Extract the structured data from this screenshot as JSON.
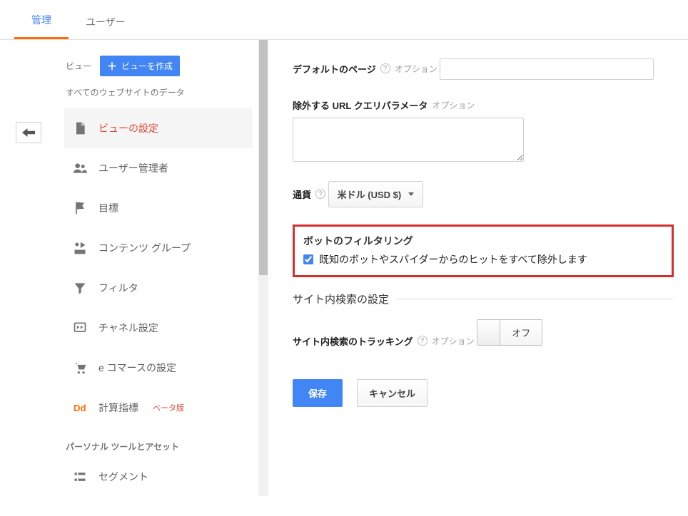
{
  "tabs": {
    "admin": "管理",
    "user": "ユーザー"
  },
  "sidebar": {
    "view_label": "ビュー",
    "create_btn": "ビューを作成",
    "subtitle": "すべてのウェブサイトのデータ",
    "items": [
      {
        "label": "ビューの設定"
      },
      {
        "label": "ユーザー管理者"
      },
      {
        "label": "目標"
      },
      {
        "label": "コンテンツ グループ"
      },
      {
        "label": "フィルタ"
      },
      {
        "label": "チャネル設定"
      },
      {
        "label": "e コマースの設定"
      },
      {
        "label": "計算指標",
        "beta": "ベータ版"
      }
    ],
    "section_title": "パーソナル ツールとアセット",
    "segment_label": "セグメント"
  },
  "content": {
    "default_page": {
      "label": "デフォルトのページ",
      "optional": "オプション"
    },
    "exclude_url": {
      "label": "除外する URL クエリパラメータ",
      "optional": "オプション"
    },
    "currency": {
      "label": "通貨",
      "value": "米ドル (USD $)"
    },
    "bot_filter": {
      "title": "ボットのフィルタリング",
      "checkbox_label": "既知のボットやスパイダーからのヒットをすべて除外します",
      "checked": true
    },
    "site_search_heading": "サイト内検索の設定",
    "site_search_tracking": {
      "label": "サイト内検索のトラッキング",
      "optional": "オプション",
      "toggle": "オフ"
    },
    "buttons": {
      "save": "保存",
      "cancel": "キャンセル"
    }
  }
}
